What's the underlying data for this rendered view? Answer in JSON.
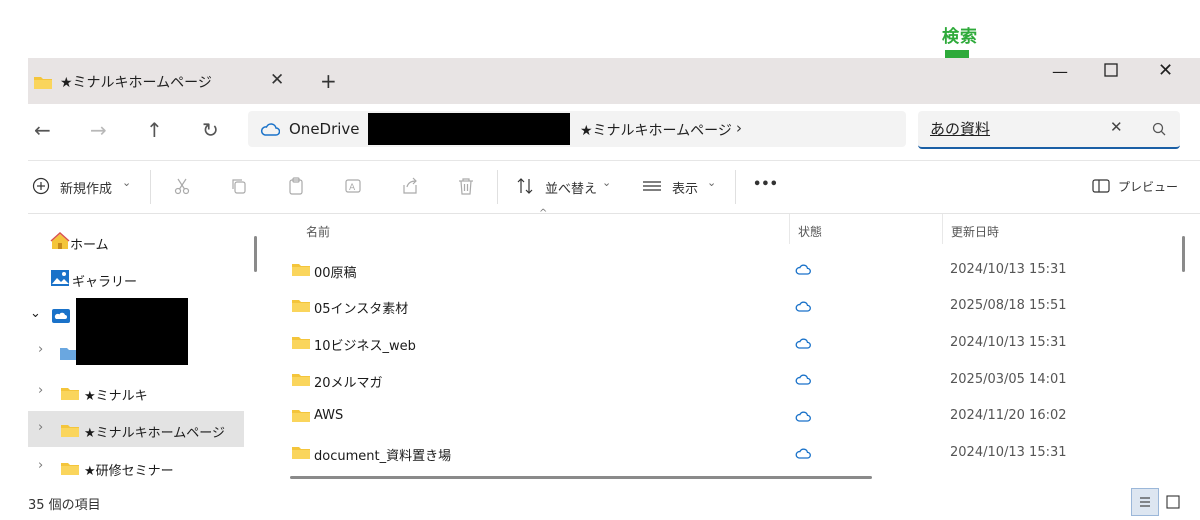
{
  "annotation": {
    "label": "検索",
    "arrow_color": "#2eaa3a"
  },
  "tab": {
    "title": "★ミナルキホームページ",
    "close": "✕",
    "new": "+"
  },
  "window_controls": {
    "minimize": "—",
    "close": "✕"
  },
  "nav": {
    "back": "←",
    "forward": "→",
    "up": "↑",
    "refresh": "↻"
  },
  "address": {
    "root": "OneDrive",
    "current": "★ミナルキホームページ",
    "chevron": "›"
  },
  "search": {
    "value": "あの資料",
    "clear": "✕"
  },
  "toolbar": {
    "new_label": "新規作成",
    "sort_label": "並べ替え",
    "view_label": "表示",
    "more_label": "•••",
    "preview_label": "プレビュー",
    "caret": "⌄"
  },
  "sidebar": {
    "home": "ホーム",
    "gallery": "ギャラリー",
    "items": [
      {
        "label": "★ミナルキ"
      },
      {
        "label": "★ミナルキホームページ"
      },
      {
        "label": "★研修セミナー"
      }
    ],
    "expand_glyph": "›",
    "expanded_glyph": "⌄"
  },
  "columns": {
    "name": "名前",
    "status": "状態",
    "modified": "更新日時",
    "sort_caret": "^"
  },
  "files": [
    {
      "name": "00原稿",
      "modified": "2024/10/13 15:31"
    },
    {
      "name": "05インスタ素材",
      "modified": "2025/08/18 15:51"
    },
    {
      "name": "10ビジネス_web",
      "modified": "2024/10/13 15:31"
    },
    {
      "name": "20メルマガ",
      "modified": "2025/03/05 14:01"
    },
    {
      "name": "AWS",
      "modified": "2024/11/20 16:02"
    },
    {
      "name": "document_資料置き場",
      "modified": "2024/10/13 15:31"
    }
  ],
  "status_bar": {
    "count": "35 個の項目"
  },
  "colors": {
    "accent": "#1a5fa5",
    "folder": "#f4c53b",
    "cloud": "#1a72c9",
    "selection": "#e3e3e3"
  }
}
